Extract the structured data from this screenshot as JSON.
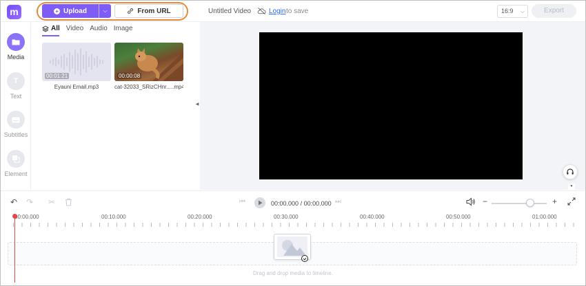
{
  "app": {
    "logo_letter": "m",
    "brand_color": "#7e5cf5",
    "highlight_color": "#e58a3d"
  },
  "toolbar": {
    "upload_label": "Upload",
    "from_url_label": "From URL",
    "document_title": "Untitled Video",
    "login_label": "Login",
    "login_suffix": "to save",
    "aspect_ratio": "16:9",
    "export_label": "Export"
  },
  "rail": {
    "items": [
      {
        "label": "Media",
        "icon": "folder-icon",
        "active": true
      },
      {
        "label": "Text",
        "icon": "text-icon",
        "active": false
      },
      {
        "label": "Subtitles",
        "icon": "subtitles-icon",
        "active": false
      },
      {
        "label": "Element",
        "icon": "element-icon",
        "active": false
      }
    ]
  },
  "media": {
    "tabs": [
      {
        "label": "All",
        "active": true
      },
      {
        "label": "Video",
        "active": false
      },
      {
        "label": "Audio",
        "active": false
      },
      {
        "label": "Image",
        "active": false
      }
    ],
    "items": [
      {
        "name": "Eyauni Email.mp3",
        "duration": "00:01:21",
        "kind": "audio"
      },
      {
        "name": "cat-32033_SRizCHnr.....mp4",
        "duration": "00:00:08",
        "kind": "video"
      }
    ]
  },
  "timeline": {
    "timecode_current": "00:00.000",
    "timecode_separator": "/",
    "timecode_total": "00:00.000",
    "ruler_labels": [
      "00:00.000",
      "00:10.000",
      "00:20.000",
      "00:30.000",
      "00:40.000",
      "00:50.000",
      "01:00.000"
    ],
    "zoom_level": 0.7,
    "drop_hint": "Drag and drop media to timeline."
  }
}
